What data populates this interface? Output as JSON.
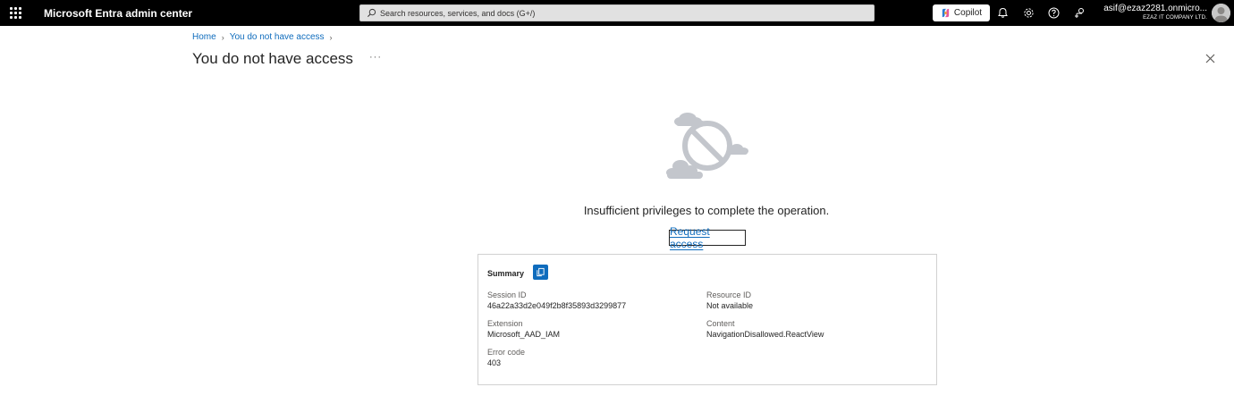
{
  "topbar": {
    "app_title": "Microsoft Entra admin center",
    "search_placeholder": "Search resources, services, and docs (G+/)",
    "copilot_label": "Copilot",
    "account_name": "asif@ezaz2281.onmicro...",
    "account_org": "EZAZ IT COMPANY LTD."
  },
  "breadcrumb": {
    "items": [
      "Home",
      "You do not have access"
    ]
  },
  "page": {
    "title": "You do not have access",
    "more_label": "···"
  },
  "error": {
    "message": "Insufficient privileges to complete the operation.",
    "request_access": "Request access"
  },
  "summary": {
    "title": "Summary",
    "fields": {
      "session_id_label": "Session ID",
      "session_id_value": "46a22a33d2e049f2b8f35893d3299877",
      "resource_id_label": "Resource ID",
      "resource_id_value": "Not available",
      "extension_label": "Extension",
      "extension_value": "Microsoft_AAD_IAM",
      "content_label": "Content",
      "content_value": "NavigationDisallowed.ReactView",
      "error_code_label": "Error code",
      "error_code_value": "403"
    }
  },
  "icons": {
    "waffle": "app-launcher-icon",
    "search": "search-icon",
    "copilot": "copilot-icon",
    "notifications": "bell-icon",
    "settings": "gear-icon",
    "help": "help-icon",
    "feedback": "feedback-icon",
    "close": "close-icon",
    "copy": "copy-icon"
  },
  "colors": {
    "topbar": "#000000",
    "link": "#0f6cbd",
    "copy_button": "#0f6cbd"
  }
}
